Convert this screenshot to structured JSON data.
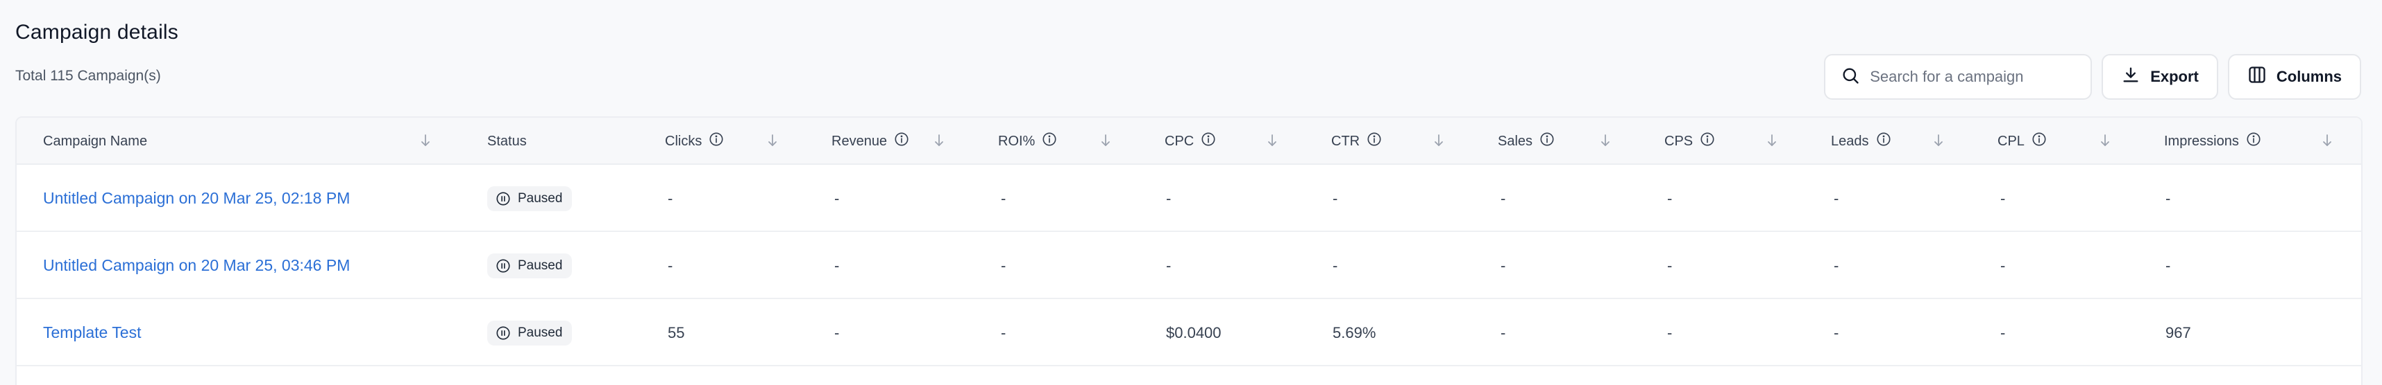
{
  "page": {
    "title": "Campaign details",
    "total": "Total 115 Campaign(s)"
  },
  "toolbar": {
    "search_placeholder": "Search for a campaign",
    "export_label": "Export",
    "columns_label": "Columns"
  },
  "table": {
    "columns": [
      {
        "label": "Campaign Name",
        "info": false
      },
      {
        "label": "Status",
        "info": false
      },
      {
        "label": "Clicks",
        "info": true
      },
      {
        "label": "Revenue",
        "info": true
      },
      {
        "label": "ROI%",
        "info": true
      },
      {
        "label": "CPC",
        "info": true
      },
      {
        "label": "CTR",
        "info": true
      },
      {
        "label": "Sales",
        "info": true
      },
      {
        "label": "CPS",
        "info": true
      },
      {
        "label": "Leads",
        "info": true
      },
      {
        "label": "CPL",
        "info": true
      },
      {
        "label": "Impressions",
        "info": true
      }
    ],
    "rows": [
      {
        "name": "Untitled Campaign on 20 Mar 25, 02:18 PM",
        "status": "Paused",
        "clicks": "-",
        "revenue": "-",
        "roi": "-",
        "cpc": "-",
        "ctr": "-",
        "sales": "-",
        "cps": "-",
        "leads": "-",
        "cpl": "-",
        "impressions": "-"
      },
      {
        "name": "Untitled Campaign on 20 Mar 25, 03:46 PM",
        "status": "Paused",
        "clicks": "-",
        "revenue": "-",
        "roi": "-",
        "cpc": "-",
        "ctr": "-",
        "sales": "-",
        "cps": "-",
        "leads": "-",
        "cpl": "-",
        "impressions": "-"
      },
      {
        "name": "Template Test",
        "status": "Paused",
        "clicks": "55",
        "revenue": "-",
        "roi": "-",
        "cpc": "$0.0400",
        "ctr": "5.69%",
        "sales": "-",
        "cps": "-",
        "leads": "-",
        "cpl": "-",
        "impressions": "967"
      }
    ]
  },
  "icons": {
    "search": "search-icon",
    "export": "download-icon",
    "columns": "columns-icon",
    "info": "info-icon",
    "sort": "arrow-down-icon",
    "status": "pause-circle-icon"
  },
  "colors": {
    "link": "#2b6fd6",
    "background": "#f8f9fb",
    "border": "#e5e7eb"
  }
}
